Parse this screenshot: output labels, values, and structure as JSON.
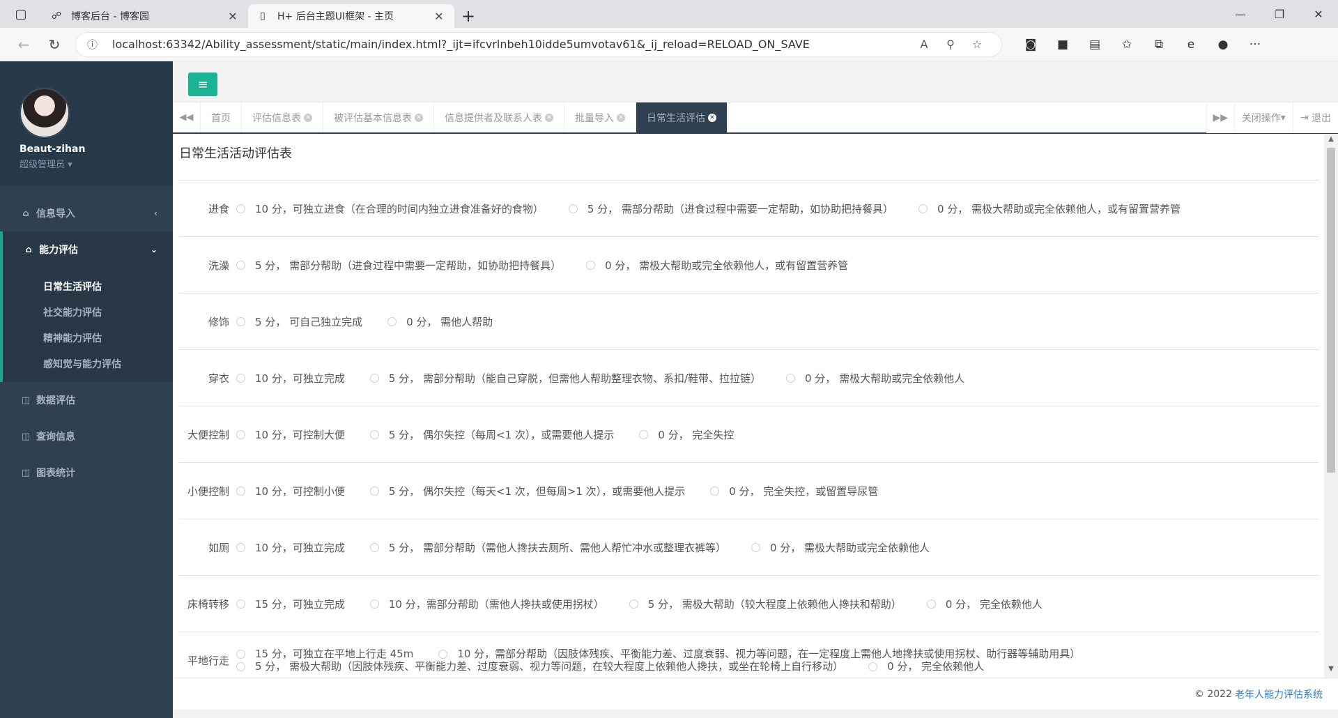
{
  "browser": {
    "tabs": [
      {
        "title": "博客后台 - 博客园"
      },
      {
        "title": "H+ 后台主题UI框架 - 主页"
      }
    ],
    "url": "localhost:63342/Ability_assessment/static/main/index.html?_ijt=ifcvrlnbeh10idde5umvotav61&_ij_reload=RELOAD_ON_SAVE"
  },
  "profile": {
    "name": "Beaut-zihan",
    "role": "超级管理员"
  },
  "menu": {
    "info_import": "信息导入",
    "ability": "能力评估",
    "ability_sub": [
      "日常生活评估",
      "社交能力评估",
      "精神能力评估",
      "感知觉与能力评估"
    ],
    "data_eval": "数据评估",
    "query": "查询信息",
    "charts": "图表统计"
  },
  "content_tabs": [
    "首页",
    "评估信息表",
    "被评估基本信息表",
    "信息提供者及联系人表",
    "批量导入",
    "日常生活评估"
  ],
  "tab_actions": {
    "close_ops": "关闭操作",
    "logout": "退出"
  },
  "form": {
    "title": "日常生活活动评估表",
    "rows": [
      {
        "label": "进食",
        "options": [
          "10 分，可独立进食（在合理的时间内独立进食准备好的食物）",
          "5 分， 需部分帮助（进食过程中需要一定帮助，如协助把持餐具）",
          "0 分， 需极大帮助或完全依赖他人，或有留置营养管"
        ]
      },
      {
        "label": "洗澡",
        "options": [
          "5 分， 需部分帮助（进食过程中需要一定帮助，如协助把持餐具）",
          "0 分， 需极大帮助或完全依赖他人，或有留置营养管"
        ]
      },
      {
        "label": "修饰",
        "options": [
          "5 分， 可自己独立完成",
          "0 分， 需他人帮助"
        ]
      },
      {
        "label": "穿衣",
        "options": [
          "10 分，可独立完成",
          "5 分， 需部分帮助（能自己穿脱，但需他人帮助整理衣物、系扣/鞋带、拉拉链）",
          "0 分， 需极大帮助或完全依赖他人"
        ]
      },
      {
        "label": "大便控制",
        "options": [
          "10 分，可控制大便",
          "5 分， 偶尔失控（每周<1 次），或需要他人提示",
          "0 分， 完全失控"
        ]
      },
      {
        "label": "小便控制",
        "options": [
          "10 分，可控制小便",
          "5 分， 偶尔失控（每天<1 次，但每周>1 次），或需要他人提示",
          "0 分， 完全失控，或留置导尿管"
        ]
      },
      {
        "label": "如厕",
        "options": [
          "10 分，可独立完成",
          "5 分， 需部分帮助（需他人搀扶去厕所、需他人帮忙冲水或整理衣裤等）",
          "0 分， 需极大帮助或完全依赖他人"
        ]
      },
      {
        "label": "床椅转移",
        "options": [
          "15 分，可独立完成",
          "10 分，需部分帮助（需他人搀扶或使用拐杖）",
          "5 分， 需极大帮助（较大程度上依赖他人搀扶和帮助）",
          "0 分， 完全依赖他人"
        ]
      },
      {
        "label": "平地行走",
        "options": [
          "15 分，可独立在平地上行走 45m",
          "10 分，需部分帮助（因肢体残疾、平衡能力差、过度衰弱、视力等问题，在一定程度上需他人地搀扶或使用拐杖、助行器等辅助用具）",
          "5 分， 需极大帮助（因肢体残疾、平衡能力差、过度衰弱、视力等问题，在较大程度上依赖他人搀扶，或坐在轮椅上自行移动）",
          "0 分， 完全依赖他人"
        ]
      }
    ]
  },
  "footer": {
    "copyright": "© 2022",
    "system": "老年人能力评估系统"
  }
}
